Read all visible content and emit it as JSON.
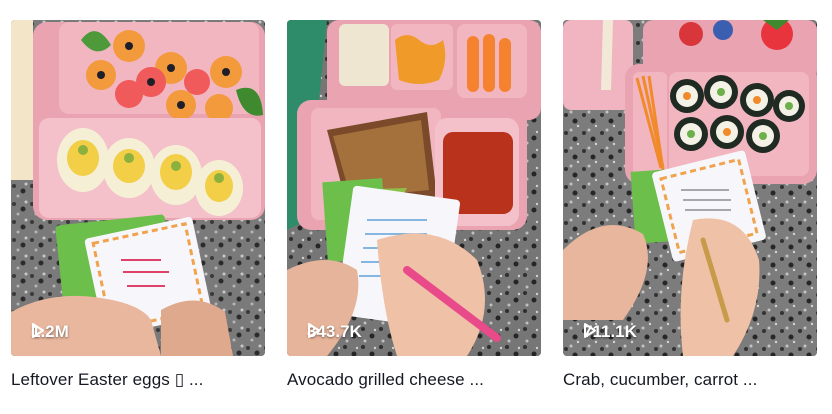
{
  "videos": [
    {
      "views": "1.2M",
      "caption": "Leftover Easter eggs ▯ ..."
    },
    {
      "views": "343.7K",
      "caption": "Avocado grilled cheese ..."
    },
    {
      "views": "711.1K",
      "caption": "Crab, cucumber, carrot ..."
    }
  ],
  "icons": {
    "views": "play-outline-icon"
  },
  "colors": {
    "caption_text": "#161823",
    "view_text": "#ffffff",
    "lunchbox": "#e9a3b1"
  }
}
